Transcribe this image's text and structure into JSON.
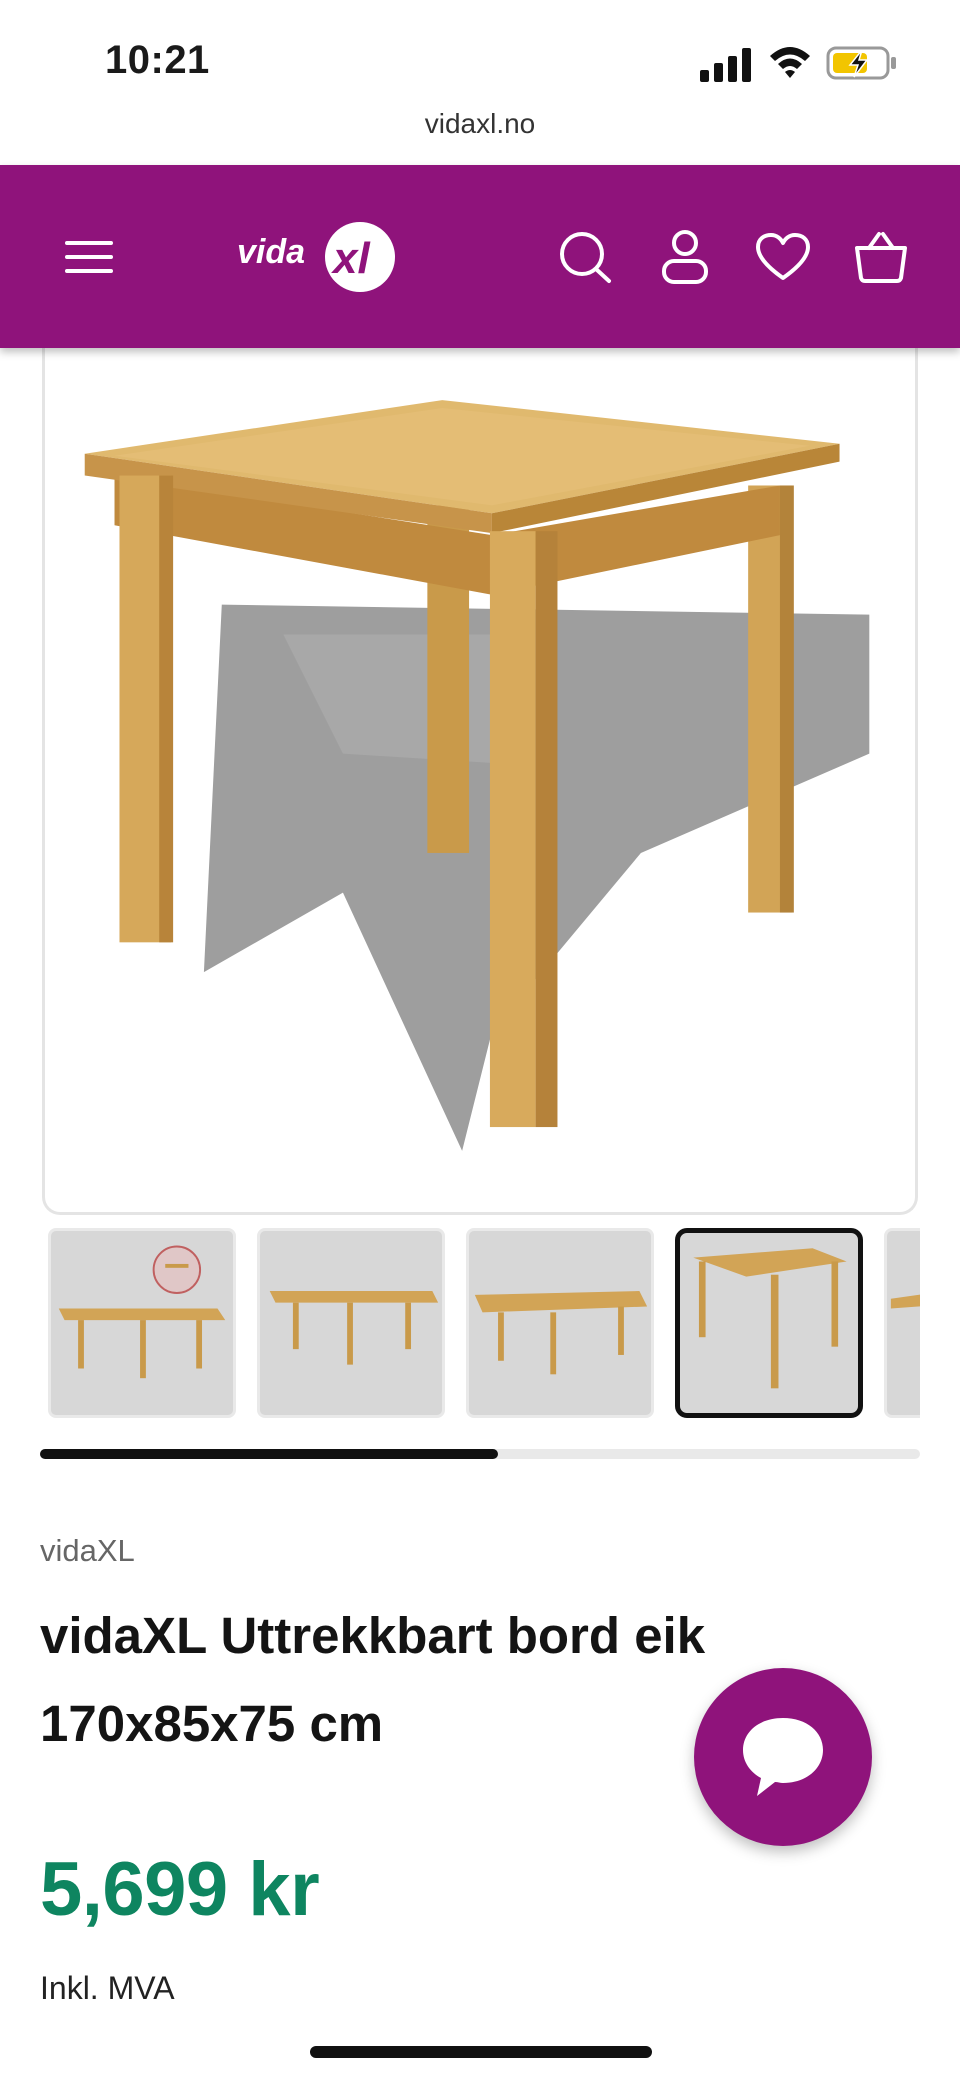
{
  "status_bar": {
    "time": "10:21"
  },
  "browser": {
    "url": "vidaxl.no"
  },
  "header": {
    "logo_text": "vidaXL",
    "background_color": "#8f137b",
    "icons": [
      "menu-icon",
      "search-icon",
      "account-icon",
      "wishlist-icon",
      "cart-icon"
    ]
  },
  "gallery": {
    "main_image": "extendable oak table",
    "thumbnails": [
      {
        "name": "thumb-extended-detail",
        "active": false
      },
      {
        "name": "thumb-extended-front",
        "active": false
      },
      {
        "name": "thumb-extended-angle",
        "active": false
      },
      {
        "name": "thumb-closed",
        "active": true
      },
      {
        "name": "thumb-partial",
        "active": false
      }
    ],
    "scroll_progress": 0.52
  },
  "product": {
    "brand": "vidaXL",
    "title": "vidaXL Uttrekkbart bord eik 170x85x75 cm",
    "price": "5,699 kr",
    "vat_note": "Inkl. MVA",
    "price_color": "#0e8560"
  }
}
